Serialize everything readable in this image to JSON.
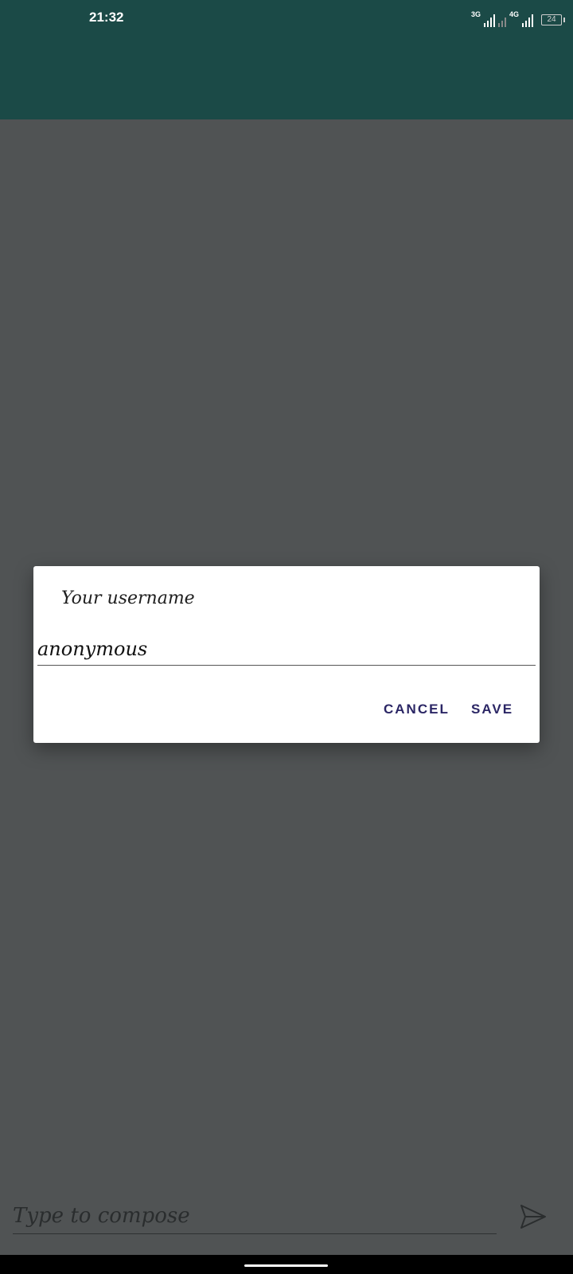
{
  "status_bar": {
    "time": "21:32",
    "network_1": "3G",
    "network_2": "4G",
    "battery": "24"
  },
  "dialog": {
    "title": "Your username",
    "input_value": "anonymous",
    "cancel_label": "CANCEL",
    "save_label": "SAVE"
  },
  "compose": {
    "placeholder": "Type to compose",
    "send_icon": "send-icon"
  },
  "colors": {
    "app_bar": "#1b4a47",
    "scrim": "#505354",
    "dialog_button": "#2b2665"
  }
}
